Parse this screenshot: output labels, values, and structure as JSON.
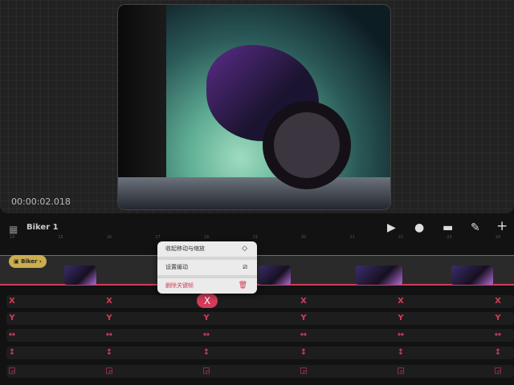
{
  "preview": {
    "timecode": "00:00:02.018"
  },
  "toolbar": {
    "layer_title": "Biker 1",
    "icons": [
      "layers-icon",
      "play-icon",
      "record-icon",
      "stack-icon",
      "pen-icon",
      "plus-icon"
    ]
  },
  "ruler": {
    "labels": [
      "14",
      "15",
      "16",
      "17",
      "18",
      "19",
      "20",
      "21",
      "22",
      "23",
      "24"
    ]
  },
  "track": {
    "chip_label": "Biker"
  },
  "context_menu": {
    "items": [
      {
        "label": "收起移动与缩放",
        "icon": "collapse-icon"
      },
      {
        "label": "设置缓动",
        "icon": "easing-icon"
      },
      {
        "label": "删除关键帧",
        "icon": "trash-icon"
      }
    ]
  },
  "properties": {
    "rows": [
      {
        "glyph": "X",
        "name": "x-position"
      },
      {
        "glyph": "Y",
        "name": "y-position"
      },
      {
        "glyph": "↔",
        "name": "scale-width"
      },
      {
        "glyph": "↕",
        "name": "scale-height"
      },
      {
        "glyph": "◲",
        "name": "rotation"
      }
    ],
    "selected_glyph": "X"
  },
  "colors": {
    "accent": "#d23c5a",
    "chip": "#c9ad4e"
  }
}
